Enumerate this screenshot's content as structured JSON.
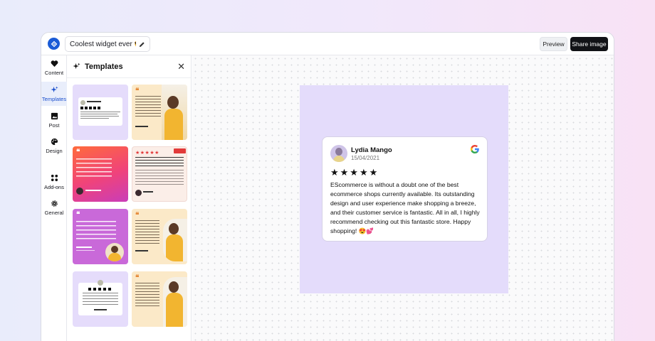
{
  "topbar": {
    "widget_title": "Coolest widget ever 😎✨",
    "preview_label": "Preview",
    "share_label": "Share image"
  },
  "rail": {
    "items": [
      {
        "label": "Content",
        "icon": "heart-icon"
      },
      {
        "label": "Templates",
        "icon": "sparkles-icon"
      },
      {
        "label": "Post",
        "icon": "image-icon"
      },
      {
        "label": "Design",
        "icon": "palette-icon"
      },
      {
        "label": "Add-ons",
        "icon": "grid-icon"
      },
      {
        "label": "General",
        "icon": "gear-icon"
      }
    ]
  },
  "panel": {
    "title": "Templates"
  },
  "review": {
    "name": "Lydia Mango",
    "date": "15/04/2021",
    "rating": "★★★★★",
    "text": "EScommerce is without a doubt one of the best ecommerce shops currently available. Its outstanding design and user experience make shopping a breeze, and their customer service is fantastic. All in all, I highly recommend checking out this fantastic store. Happy shopping! 😍💕"
  },
  "colors": {
    "accent": "#1a5bd6",
    "artboard": "#e4dcfb",
    "share_button": "#111216"
  }
}
